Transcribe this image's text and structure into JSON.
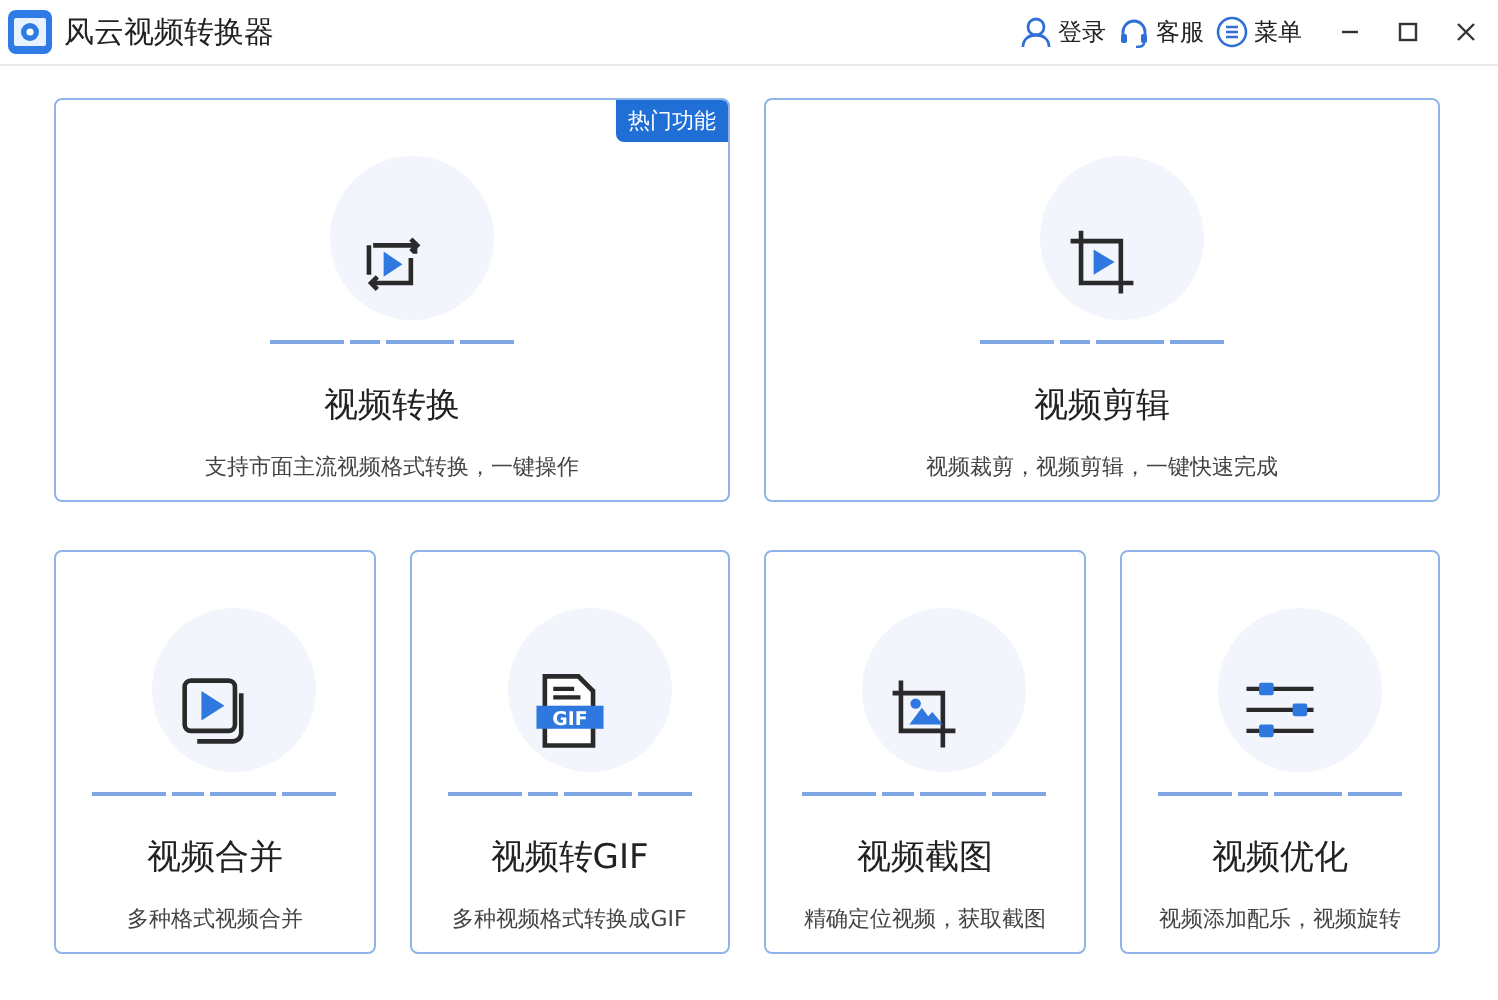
{
  "window": {
    "title": "风云视频转换器"
  },
  "header_actions": [
    {
      "kind": "user",
      "label": "登录"
    },
    {
      "kind": "headset",
      "label": "客服"
    },
    {
      "kind": "menu",
      "label": "菜单"
    }
  ],
  "window_controls": [
    {
      "kind": "minimize"
    },
    {
      "kind": "maximize"
    },
    {
      "kind": "close"
    }
  ],
  "main_features": [
    {
      "kind": "convert",
      "title": "视频转换",
      "description": "支持市面主流视频格式转换，一键操作",
      "badge": "热门功能"
    },
    {
      "kind": "trim",
      "title": "视频剪辑",
      "description": "视频裁剪，视频剪辑，一键快速完成"
    }
  ],
  "more_features": [
    {
      "kind": "merge",
      "title": "视频合并",
      "description": "多种格式视频合并"
    },
    {
      "kind": "gif",
      "title": "视频转GIF",
      "description": "多种视频格式转换成GIF",
      "icon_text": "GIF"
    },
    {
      "kind": "screenshot",
      "title": "视频截图",
      "description": "精确定位视频，获取截图"
    },
    {
      "kind": "optimize",
      "title": "视频优化",
      "description": "视频添加配乐，视频旋转"
    }
  ]
}
